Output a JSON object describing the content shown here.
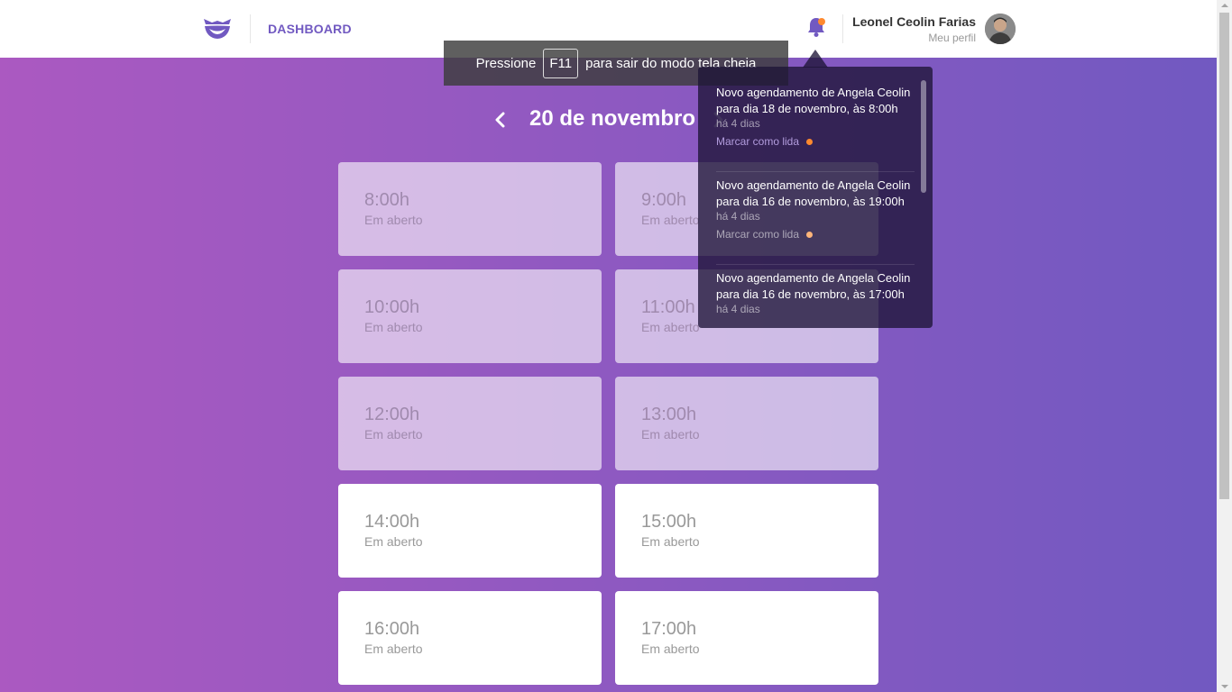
{
  "header": {
    "logo_icon": "mustache-logo-icon",
    "nav_label": "DASHBOARD",
    "bell_icon": "bell-icon",
    "profile_name": "Leonel Ceolin Farias",
    "profile_link": "Meu perfil"
  },
  "fullscreen_notice": {
    "before": "Pressione",
    "key": "F11",
    "after": "para sair do modo tela cheia"
  },
  "date_nav": {
    "title": "20 de novembro",
    "prev_icon": "chevron-left-icon",
    "next_icon": "chevron-right-icon"
  },
  "slots": [
    {
      "time": "8:00h",
      "status": "Em aberto",
      "past": true
    },
    {
      "time": "9:00h",
      "status": "Em aberto",
      "past": true
    },
    {
      "time": "10:00h",
      "status": "Em aberto",
      "past": true
    },
    {
      "time": "11:00h",
      "status": "Em aberto",
      "past": true
    },
    {
      "time": "12:00h",
      "status": "Em aberto",
      "past": true
    },
    {
      "time": "13:00h",
      "status": "Em aberto",
      "past": true
    },
    {
      "time": "14:00h",
      "status": "Em aberto",
      "past": false
    },
    {
      "time": "15:00h",
      "status": "Em aberto",
      "past": false
    },
    {
      "time": "16:00h",
      "status": "Em aberto",
      "past": false
    },
    {
      "time": "17:00h",
      "status": "Em aberto",
      "past": false
    }
  ],
  "notifications": [
    {
      "text": "Novo agendamento de Angela Ceolin para dia 18 de novembro, às 8:00h",
      "time": "há 4 dias",
      "action": "Marcar como lida"
    },
    {
      "text": "Novo agendamento de Angela Ceolin para dia 16 de novembro, às 19:00h",
      "time": "há 4 dias",
      "action": "Marcar como lida"
    },
    {
      "text": "Novo agendamento de Angela Ceolin para dia 16 de novembro, às 17:00h",
      "time": "há 4 dias",
      "action": ""
    }
  ],
  "colors": {
    "accent": "#7159c1",
    "gradient_start": "#ab59c1",
    "gradient_end": "#7159c1",
    "unread_dot": "#ff892e"
  }
}
